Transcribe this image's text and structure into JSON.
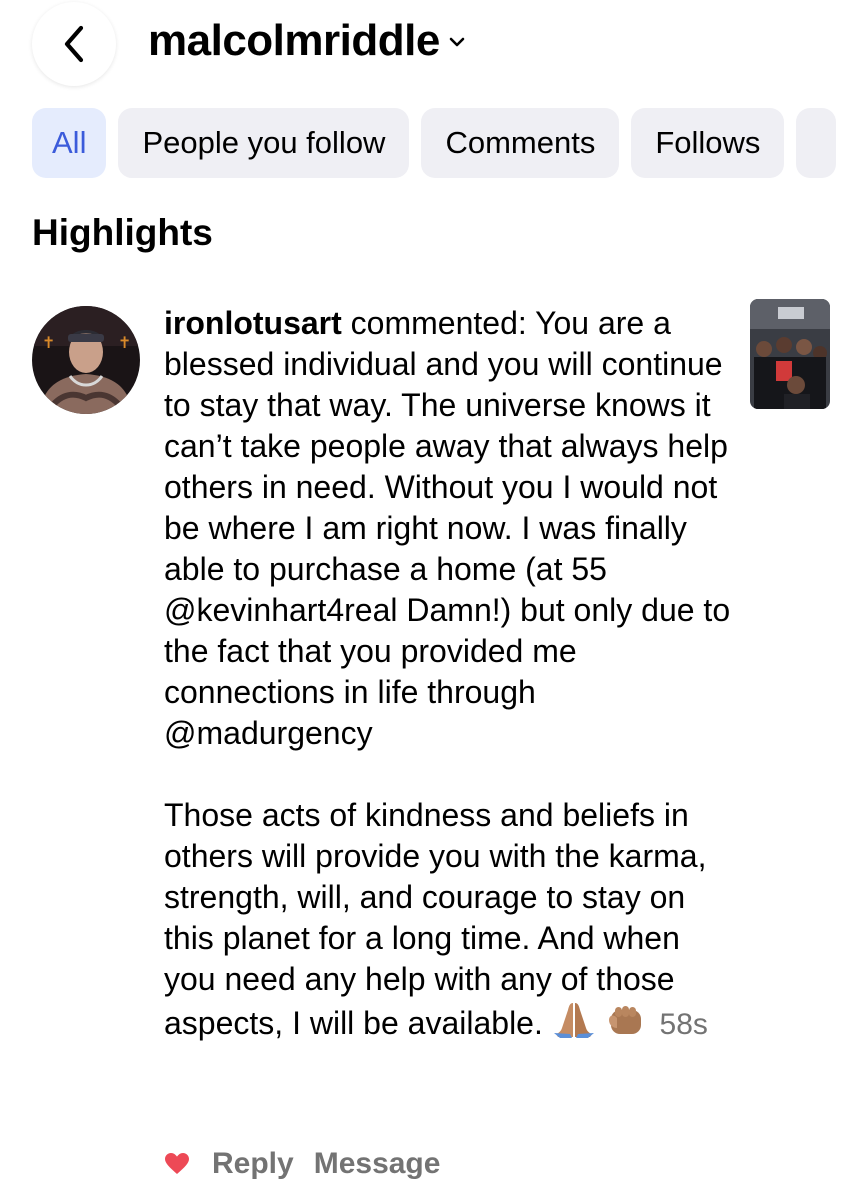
{
  "header": {
    "title": "malcolmriddle"
  },
  "filters": [
    {
      "label": "All",
      "active": true
    },
    {
      "label": "People you follow",
      "active": false
    },
    {
      "label": "Comments",
      "active": false
    },
    {
      "label": "Follows",
      "active": false
    }
  ],
  "section": {
    "title": "Highlights"
  },
  "notification": {
    "username": "ironlotusart",
    "action": "commented:",
    "paragraph1": "You are a blessed individual and you will continue to stay that way.  The universe knows it can’t take people away that always help others in need.  Without you I would not be where I am right now.  I was finally able to purchase a home (at 55 @kevinhart4real Damn!) but only due to the fact that you provided me connections in life through @madurgency",
    "paragraph2": "Those acts of kindness and beliefs in others will provide you with the karma, strength, will, and courage to stay on this planet for a long time.  And when you need any help with any of those aspects, I will be available.",
    "emojis": [
      "folded-hands-emoji",
      "fist-bump-emoji"
    ],
    "time": "58s",
    "reply_label": "Reply",
    "message_label": "Message",
    "like_color": "#ed4956"
  },
  "colors": {
    "accent": "#3b5bdb",
    "chip_bg": "#efeff4",
    "active_chip_bg": "#e5ecfd",
    "secondary_text": "#737373"
  },
  "icons": {
    "back": "chevron-left-icon",
    "title_dropdown": "chevron-down-icon",
    "like": "heart-icon"
  }
}
